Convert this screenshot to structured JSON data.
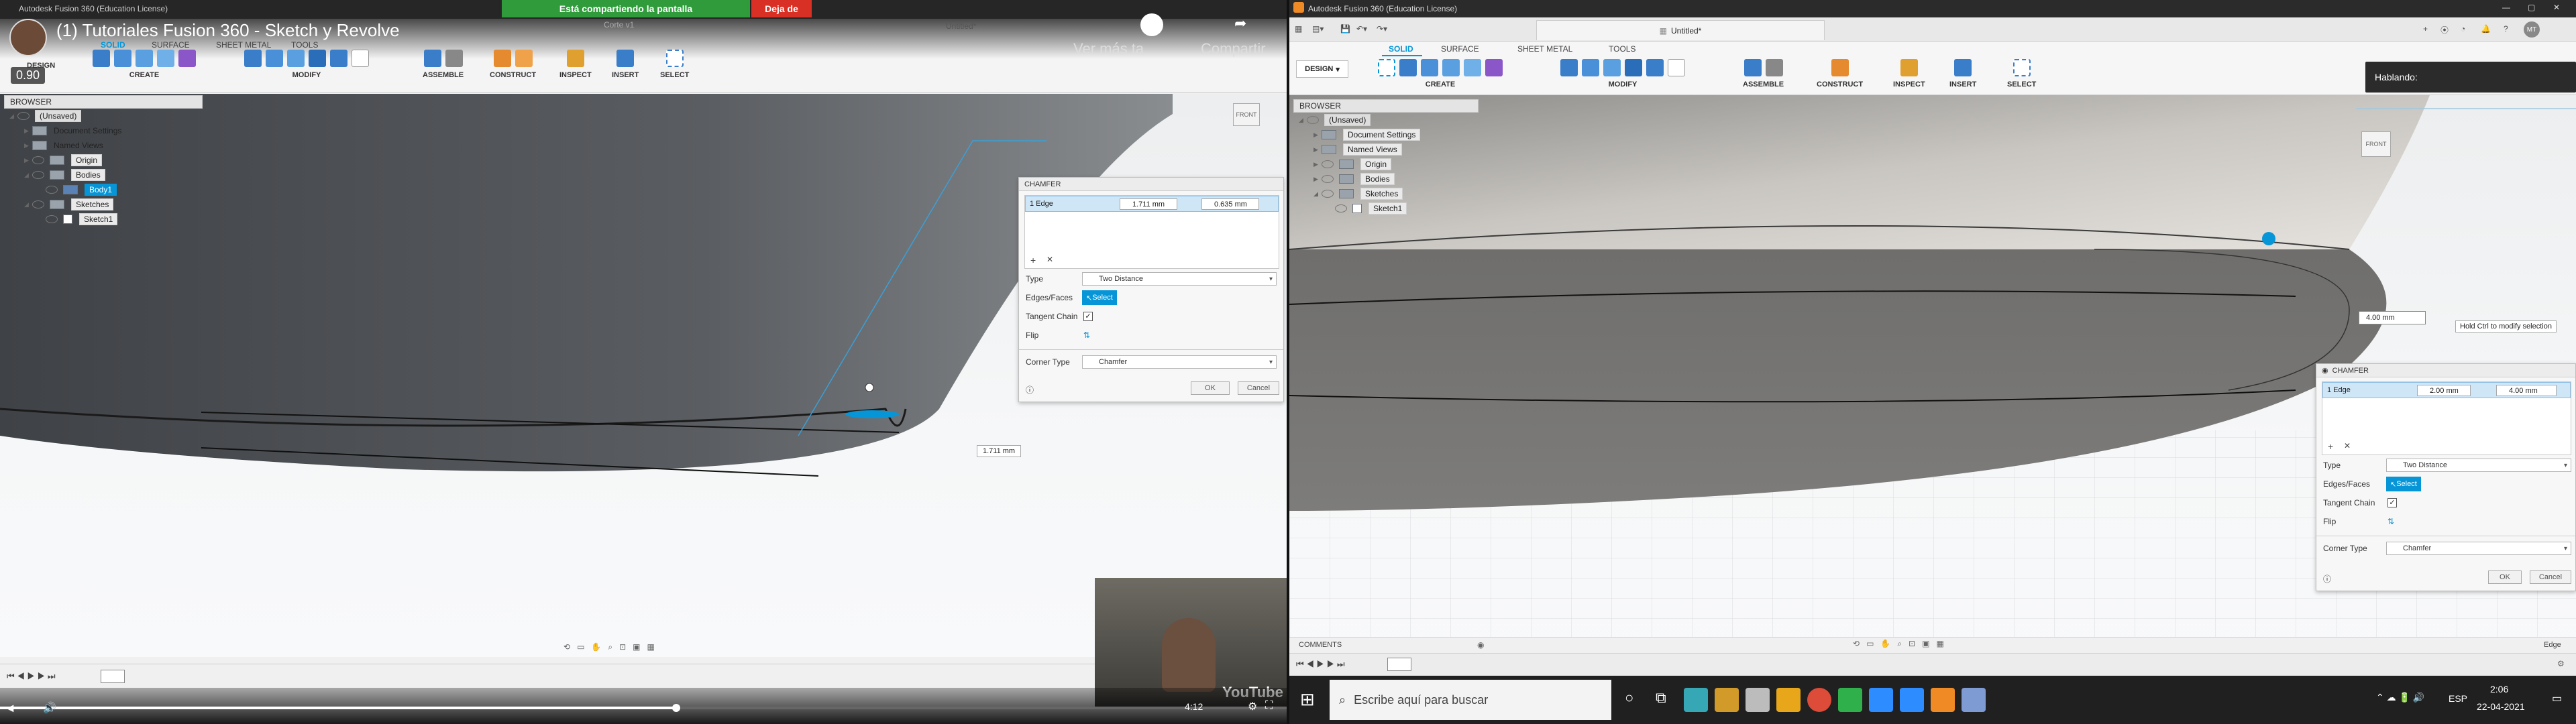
{
  "left": {
    "window_title": "Autodesk Fusion 360 (Education License)",
    "video_title": "(1) Tutoriales Fusion 360 - Sketch y Revolve",
    "share_banner": "Está compartiendo la pantalla",
    "share_stop": "Deja de",
    "bg_tab1": "Corte v1",
    "bg_tab2": "Untitled*",
    "speed_badge": "0.90",
    "workspace": "DESIGN",
    "tabs": [
      "SOLID",
      "SURFACE",
      "SHEET METAL",
      "TOOLS"
    ],
    "groups": [
      "CREATE",
      "MODIFY",
      "ASSEMBLE",
      "CONSTRUCT",
      "INSPECT",
      "INSERT",
      "SELECT"
    ],
    "ghost_labels": [
      "Ver más ta",
      "Compartir"
    ],
    "browser": {
      "header": "BROWSER",
      "items": [
        "(Unsaved)",
        "Document Settings",
        "Named Views",
        "Origin",
        "Bodies",
        "Body1",
        "Sketches",
        "Sketch1"
      ]
    },
    "chamfer": {
      "title": "CHAMFER",
      "selection": "1 Edge",
      "distance1": "1.711 mm",
      "distance2": "0.635 mm",
      "type_label": "Type",
      "type_value": "Two Distance",
      "edges_label": "Edges/Faces",
      "select_btn": "Select",
      "tangent_label": "Tangent Chain",
      "flip_label": "Flip",
      "corner_label": "Corner Type",
      "corner_value": "Chamfer",
      "ok": "OK",
      "cancel": "Cancel"
    },
    "dim_callout": "1.711 mm",
    "viewcube": "FRONT",
    "video_time": "4:12",
    "youtube": "YouTube"
  },
  "right": {
    "window_title": "Autodesk Fusion 360 (Education License)",
    "doc_title": "Untitled*",
    "workspace": "DESIGN",
    "tabs": [
      "SOLID",
      "SURFACE",
      "SHEET METAL",
      "TOOLS"
    ],
    "groups": [
      "CREATE",
      "MODIFY",
      "ASSEMBLE",
      "CONSTRUCT",
      "INSPECT",
      "INSERT",
      "SELECT"
    ],
    "toast": "Hablando:",
    "user_initials": "MT",
    "browser": {
      "header": "BROWSER",
      "items": [
        "(Unsaved)",
        "Document Settings",
        "Named Views",
        "Origin",
        "Bodies",
        "Sketches",
        "Sketch1"
      ]
    },
    "dim_input": "4.00 mm",
    "tooltip": "Hold Ctrl to modify selection",
    "chamfer": {
      "title": "CHAMFER",
      "selection": "1 Edge",
      "distance1": "2.00 mm",
      "distance2": "4.00 mm",
      "type_label": "Type",
      "type_value": "Two Distance",
      "edges_label": "Edges/Faces",
      "select_btn": "Select",
      "tangent_label": "Tangent Chain",
      "flip_label": "Flip",
      "corner_label": "Corner Type",
      "corner_value": "Chamfer",
      "ok": "OK",
      "cancel": "Cancel"
    },
    "viewcube": "FRONT",
    "comments": "COMMENTS",
    "status_right": "Edge"
  },
  "taskbar": {
    "search_placeholder": "Escribe aquí para buscar",
    "language": "ESP",
    "time": "2:06",
    "date": "22-04-2021"
  },
  "colors": {
    "accent": "#0696d7",
    "share_green": "#2f9b3b",
    "stop_red": "#d93025",
    "taskbar": "#202020"
  }
}
